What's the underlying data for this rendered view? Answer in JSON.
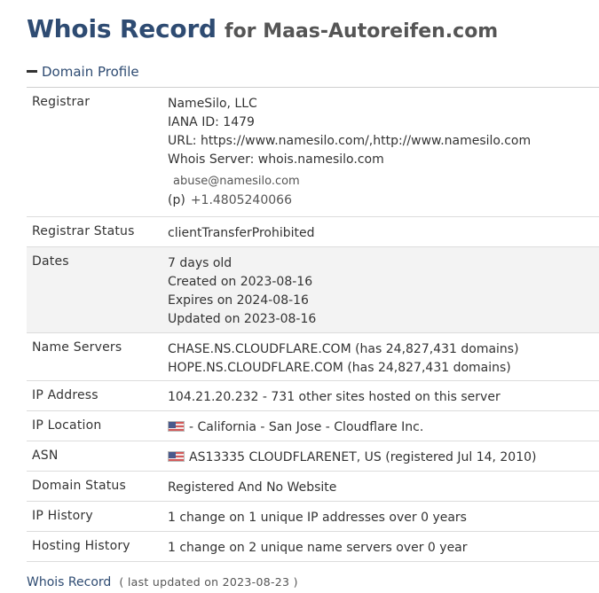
{
  "header": {
    "title": "Whois Record",
    "subtitle": "for Maas-Autoreifen.com"
  },
  "section": {
    "label": "Domain Profile"
  },
  "profile": {
    "registrar": {
      "key": "Registrar",
      "name": "NameSilo, LLC",
      "iana": "IANA ID: 1479",
      "url": "URL: https://www.namesilo.com/,http://www.namesilo.com",
      "whois_server": "Whois Server: whois.namesilo.com",
      "abuse_email": "abuse@namesilo.com",
      "phone_label": "(p)",
      "phone": "+1.4805240066"
    },
    "status": {
      "key": "Registrar Status",
      "value": "clientTransferProhibited"
    },
    "dates": {
      "key": "Dates",
      "age": "7 days old",
      "created": "Created on 2023-08-16",
      "expires": "Expires on 2024-08-16",
      "updated": "Updated on 2023-08-16"
    },
    "name_servers": {
      "key": "Name Servers",
      "ns1": "CHASE.NS.CLOUDFLARE.COM (has 24,827,431 domains)",
      "ns2": "HOPE.NS.CLOUDFLARE.COM (has 24,827,431 domains)"
    },
    "ip_address": {
      "key": "IP Address",
      "value": "104.21.20.232 - 731 other sites hosted on this server"
    },
    "ip_location": {
      "key": "IP Location",
      "value": "- California - San Jose - Cloudflare Inc.",
      "flag_icon": "us-flag-icon"
    },
    "asn": {
      "key": "ASN",
      "value": "AS13335 CLOUDFLARENET, US (registered Jul 14, 2010)",
      "flag_icon": "us-flag-icon"
    },
    "domain_status": {
      "key": "Domain Status",
      "value": "Registered And No Website"
    },
    "ip_history": {
      "key": "IP History",
      "value": "1 change on 1 unique IP addresses over 0 years"
    },
    "hosting_history": {
      "key": "Hosting History",
      "value": "1 change on 2 unique name servers over 0 year"
    }
  },
  "footer": {
    "label": "Whois Record",
    "updated": "( last updated on 2023-08-23 )"
  },
  "colors": {
    "title": "#2e4b72",
    "alt_row": "#f3f3f3",
    "border": "#dcdcdc"
  }
}
